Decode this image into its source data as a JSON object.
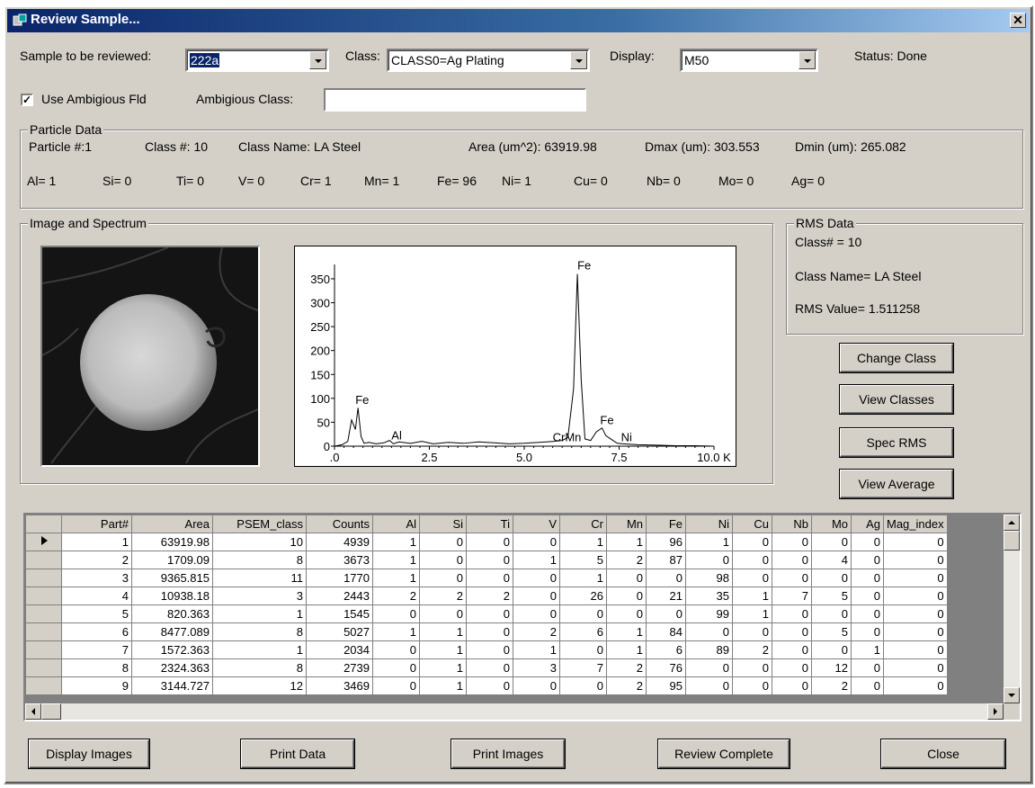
{
  "window": {
    "title": "Review Sample...",
    "close_glyph": "✕"
  },
  "top": {
    "sample_label": "Sample to be reviewed:",
    "sample_value": "222a",
    "class_label": "Class:",
    "class_value": "CLASS0=Ag Plating",
    "display_label": "Display:",
    "display_value": "M50",
    "status_text": "Status: Done",
    "use_ambig_label": "Use Ambigious Fld",
    "use_ambig_checked": true,
    "ambig_class_label": "Ambigious Class:",
    "ambig_class_value": ""
  },
  "particle": {
    "group_title": "Particle Data",
    "row1": [
      "Particle #:1",
      "Class #: 10",
      "Class Name: LA Steel",
      "Area (um^2): 63919.98",
      "Dmax (um): 303.553",
      "Dmin (um): 265.082"
    ],
    "row2": [
      "Al= 1",
      "Si= 0",
      "Ti= 0",
      "V= 0",
      "Cr= 1",
      "Mn= 1",
      "Fe= 96",
      "Ni= 1",
      "Cu= 0",
      "Nb= 0",
      "Mo= 0",
      "Ag= 0"
    ]
  },
  "image_group_title": "Image and Spectrum",
  "rms": {
    "group_title": "RMS Data",
    "class_no": "Class# = 10",
    "class_name": "Class Name= LA Steel",
    "rms_value": "RMS Value= 1.511258"
  },
  "side_buttons": {
    "change_class": "Change Class",
    "view_classes": "View Classes",
    "spec_rms": "Spec RMS",
    "view_average": "View Average"
  },
  "chart_data": {
    "type": "line",
    "title": "",
    "xlabel": "",
    "ylabel": "",
    "xlim": [
      0,
      10
    ],
    "ylim": [
      0,
      380
    ],
    "x_ticks": [
      ".0",
      "2.5",
      "5.0",
      "7.5",
      "10.0 K"
    ],
    "y_ticks": [
      "0",
      "50",
      "100",
      "150",
      "200",
      "250",
      "300",
      "350"
    ],
    "x_tick_values": [
      0,
      2.5,
      5.0,
      7.5,
      10.0
    ],
    "y_tick_values": [
      0,
      50,
      100,
      150,
      200,
      250,
      300,
      350
    ],
    "series": [
      {
        "x": [
          0.0,
          0.2,
          0.35,
          0.45,
          0.55,
          0.62,
          0.7,
          0.78,
          0.9,
          1.1,
          1.3,
          1.45,
          1.55,
          1.7,
          2.0,
          2.3,
          2.6,
          3.0,
          3.4,
          3.8,
          4.2,
          4.6,
          5.0,
          5.4,
          5.8,
          6.0,
          6.15,
          6.3,
          6.4,
          6.5,
          6.6,
          6.75,
          6.9,
          7.05,
          7.15,
          7.3,
          7.45,
          7.6,
          8.0,
          8.5,
          9.0,
          9.5,
          10.0
        ],
        "y": [
          0,
          3,
          10,
          55,
          35,
          80,
          20,
          6,
          8,
          5,
          7,
          12,
          5,
          9,
          6,
          10,
          5,
          8,
          6,
          9,
          7,
          5,
          6,
          8,
          10,
          12,
          18,
          120,
          360,
          140,
          15,
          12,
          30,
          38,
          22,
          14,
          6,
          5,
          3,
          2,
          1,
          1,
          0
        ]
      }
    ],
    "annotations": [
      {
        "text": "Fe",
        "x": 0.55,
        "y": 88
      },
      {
        "text": "Al",
        "x": 1.5,
        "y": 14
      },
      {
        "text": "CrMn",
        "x": 5.75,
        "y": 10
      },
      {
        "text": "Fe",
        "x": 6.4,
        "y": 370
      },
      {
        "text": "Fe",
        "x": 7.0,
        "y": 46
      },
      {
        "text": "Ni",
        "x": 7.55,
        "y": 10
      }
    ]
  },
  "table": {
    "columns": [
      "Part#",
      "Area",
      "PSEM_class",
      "Counts",
      "Al",
      "Si",
      "Ti",
      "V",
      "Cr",
      "Mn",
      "Fe",
      "Ni",
      "Cu",
      "Nb",
      "Mo",
      "Ag",
      "Mag_index"
    ],
    "rows": [
      [
        "1",
        "63919.98",
        "10",
        "4939",
        "1",
        "0",
        "0",
        "0",
        "1",
        "1",
        "96",
        "1",
        "0",
        "0",
        "0",
        "0",
        "0"
      ],
      [
        "2",
        "1709.09",
        "8",
        "3673",
        "1",
        "0",
        "0",
        "1",
        "5",
        "2",
        "87",
        "0",
        "0",
        "0",
        "4",
        "0",
        "0"
      ],
      [
        "3",
        "9365.815",
        "11",
        "1770",
        "1",
        "0",
        "0",
        "0",
        "1",
        "0",
        "0",
        "98",
        "0",
        "0",
        "0",
        "0",
        "0"
      ],
      [
        "4",
        "10938.18",
        "3",
        "2443",
        "2",
        "2",
        "2",
        "0",
        "26",
        "0",
        "21",
        "35",
        "1",
        "7",
        "5",
        "0",
        "0"
      ],
      [
        "5",
        "820.363",
        "1",
        "1545",
        "0",
        "0",
        "0",
        "0",
        "0",
        "0",
        "0",
        "99",
        "1",
        "0",
        "0",
        "0",
        "0"
      ],
      [
        "6",
        "8477.089",
        "8",
        "5027",
        "1",
        "1",
        "0",
        "2",
        "6",
        "1",
        "84",
        "0",
        "0",
        "0",
        "5",
        "0",
        "0"
      ],
      [
        "7",
        "1572.363",
        "1",
        "2034",
        "0",
        "1",
        "0",
        "1",
        "0",
        "1",
        "6",
        "89",
        "2",
        "0",
        "0",
        "1",
        "0"
      ],
      [
        "8",
        "2324.363",
        "8",
        "2739",
        "0",
        "1",
        "0",
        "3",
        "7",
        "2",
        "76",
        "0",
        "0",
        "0",
        "12",
        "0",
        "0"
      ],
      [
        "9",
        "3144.727",
        "12",
        "3469",
        "0",
        "1",
        "0",
        "0",
        "0",
        "2",
        "95",
        "0",
        "0",
        "0",
        "2",
        "0",
        "0"
      ]
    ]
  },
  "bottom_buttons": {
    "display_images": "Display Images",
    "print_data": "Print Data",
    "print_images": "Print Images",
    "review_complete": "Review Complete",
    "close": "Close"
  }
}
